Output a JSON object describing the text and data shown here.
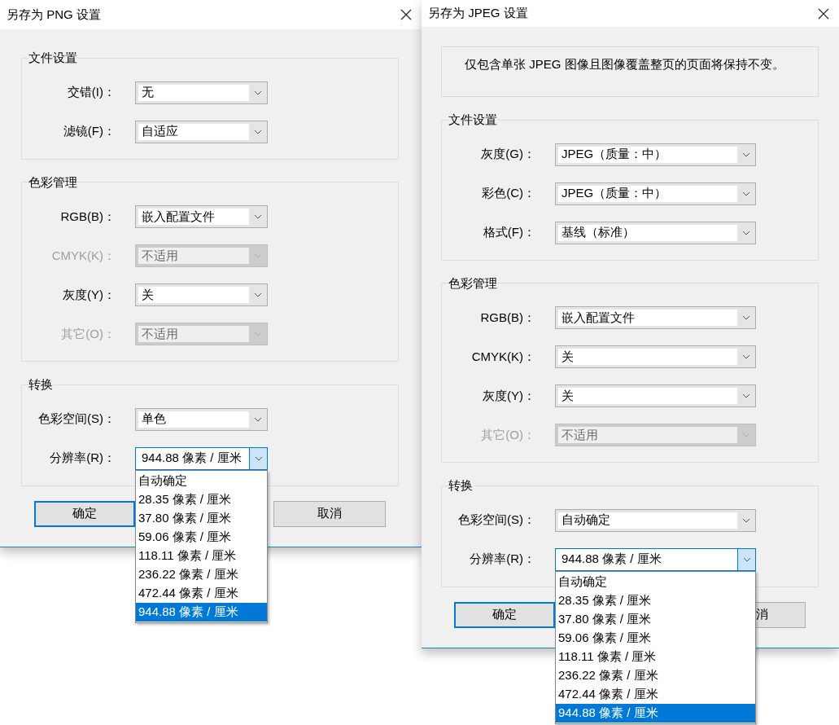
{
  "dialogs": [
    {
      "title": "另存为 PNG 设置",
      "groups": [
        {
          "title": "文件设置",
          "fields": [
            {
              "label": "交错(I)：",
              "value": "无",
              "disabled": false,
              "open": false
            },
            {
              "label": "滤镜(F)：",
              "value": "自适应",
              "disabled": false,
              "open": false
            }
          ]
        },
        {
          "title": "色彩管理",
          "fields": [
            {
              "label": "RGB(B)：",
              "value": "嵌入配置文件",
              "disabled": false,
              "open": false
            },
            {
              "label": "CMYK(K)：",
              "value": "不适用",
              "disabled": true,
              "open": false
            },
            {
              "label": "灰度(Y)：",
              "value": "关",
              "disabled": false,
              "open": false
            },
            {
              "label": "其它(O)：",
              "value": "不适用",
              "disabled": true,
              "open": false
            }
          ]
        },
        {
          "title": "转换",
          "fields": [
            {
              "label": "色彩空间(S)：",
              "value": "单色",
              "disabled": false,
              "open": false
            },
            {
              "label": "分辨率(R)：",
              "value": "944.88 像素 / 厘米",
              "disabled": false,
              "open": true,
              "options": [
                {
                  "label": "自动确定",
                  "selected": false
                },
                {
                  "label": "28.35 像素 / 厘米",
                  "selected": false
                },
                {
                  "label": "37.80 像素 / 厘米",
                  "selected": false
                },
                {
                  "label": "59.06 像素 / 厘米",
                  "selected": false
                },
                {
                  "label": "118.11 像素 / 厘米",
                  "selected": false
                },
                {
                  "label": "236.22 像素 / 厘米",
                  "selected": false
                },
                {
                  "label": "472.44 像素 / 厘米",
                  "selected": false
                },
                {
                  "label": "944.88 像素 / 厘米",
                  "selected": true
                }
              ]
            }
          ]
        }
      ],
      "buttons": [
        {
          "label": "确定",
          "default": true,
          "covered": false
        },
        {
          "label": "取消",
          "default": false,
          "covered": false
        }
      ]
    },
    {
      "title": "另存为 JPEG 设置",
      "info": "仅包含单张 JPEG 图像且图像覆盖整页的页面将保持不变。",
      "groups": [
        {
          "title": "文件设置",
          "fields": [
            {
              "label": "灰度(G)：",
              "value": "JPEG（质量：中）",
              "disabled": false,
              "open": false
            },
            {
              "label": "彩色(C)：",
              "value": "JPEG（质量：中）",
              "disabled": false,
              "open": false
            },
            {
              "label": "格式(F)：",
              "value": "基线（标准）",
              "disabled": false,
              "open": false
            }
          ]
        },
        {
          "title": "色彩管理",
          "fields": [
            {
              "label": "RGB(B)：",
              "value": "嵌入配置文件",
              "disabled": false,
              "open": false
            },
            {
              "label": "CMYK(K)：",
              "value": "关",
              "disabled": false,
              "open": false
            },
            {
              "label": "灰度(Y)：",
              "value": "关",
              "disabled": false,
              "open": false
            },
            {
              "label": "其它(O)：",
              "value": "不适用",
              "disabled": true,
              "open": false
            }
          ]
        },
        {
          "title": "转换",
          "fields": [
            {
              "label": "色彩空间(S)：",
              "value": "自动确定",
              "disabled": false,
              "open": false
            },
            {
              "label": "分辨率(R)：",
              "value": "944.88 像素 / 厘米",
              "disabled": false,
              "open": true,
              "options": [
                {
                  "label": "自动确定",
                  "selected": false
                },
                {
                  "label": "28.35 像素 / 厘米",
                  "selected": false
                },
                {
                  "label": "37.80 像素 / 厘米",
                  "selected": false
                },
                {
                  "label": "59.06 像素 / 厘米",
                  "selected": false
                },
                {
                  "label": "118.11 像素 / 厘米",
                  "selected": false
                },
                {
                  "label": "236.22 像素 / 厘米",
                  "selected": false
                },
                {
                  "label": "472.44 像素 / 厘米",
                  "selected": false
                },
                {
                  "label": "944.88 像素 / 厘米",
                  "selected": true
                }
              ]
            }
          ]
        }
      ],
      "buttons": [
        {
          "label": "确定",
          "default": true,
          "covered": false
        },
        {
          "label": "消",
          "default": false,
          "covered": true
        }
      ]
    }
  ]
}
